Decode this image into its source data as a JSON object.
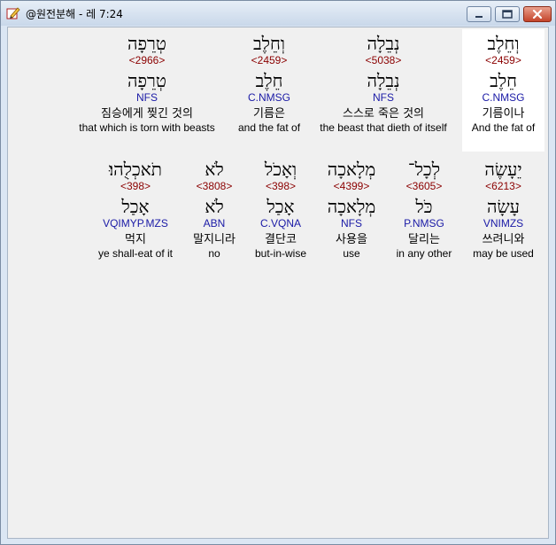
{
  "window": {
    "title": "@원전분해 - 레 7:24",
    "app_icon": "edit-pencil-icon",
    "buttons": {
      "minimize": "minimize-icon",
      "maximize": "maximize-icon",
      "close": "close-icon"
    }
  },
  "rows": [
    {
      "words": [
        {
          "heb": "וְחֵלֶב",
          "strong": "<2459>",
          "lemma": "חֵלֶב",
          "morph": "C.NMSG",
          "kor": "기름이나",
          "eng": "And the fat of",
          "highlight": true
        },
        {
          "heb": "נְבֵלָה",
          "strong": "<5038>",
          "lemma": "נְבֵלָה",
          "morph": "NFS",
          "kor": "스스로 죽은 것의",
          "eng": "the beast that dieth of itself"
        },
        {
          "heb": "וְחֵלֶב",
          "strong": "<2459>",
          "lemma": "חֵלֶב",
          "morph": "C.NMSG",
          "kor": "기름은",
          "eng": "and the fat of"
        },
        {
          "heb": "טְרֵפָה",
          "strong": "<2966>",
          "lemma": "טְרֵפָה",
          "morph": "NFS",
          "kor": "짐승에게 찢긴 것의",
          "eng": "that which is torn with beasts"
        }
      ]
    },
    {
      "words": [
        {
          "heb": "יֵעָשֶׂה",
          "strong": "<6213>",
          "lemma": "עָשָׂה",
          "morph": "VNIMZS",
          "kor": "쓰려니와",
          "eng": "may be used"
        },
        {
          "heb": "לְכָל־",
          "strong": "<3605>",
          "lemma": "כֹּל",
          "morph": "P.NMSG",
          "kor": "달리는",
          "eng": "in any other"
        },
        {
          "heb": "מְלָאכָה",
          "strong": "<4399>",
          "lemma": "מְלָאכָה",
          "morph": "NFS",
          "kor": "사용을",
          "eng": "use"
        },
        {
          "heb": "וְאָכֹל",
          "strong": "<398>",
          "lemma": "אָכַל",
          "morph": "C.VQNA",
          "kor": "결단코",
          "eng": "but-in-wise"
        },
        {
          "heb": "לֹא",
          "strong": "<3808>",
          "lemma": "לֹא",
          "morph": "ABN",
          "kor": "말지니라",
          "eng": "no"
        },
        {
          "heb": "תֹאכְלֻהוּ׃",
          "strong": "<398>",
          "lemma": "אָכַל",
          "morph": "VQIMYP.MZS",
          "kor": "먹지",
          "eng": "ye shall-eat of it"
        }
      ]
    }
  ]
}
